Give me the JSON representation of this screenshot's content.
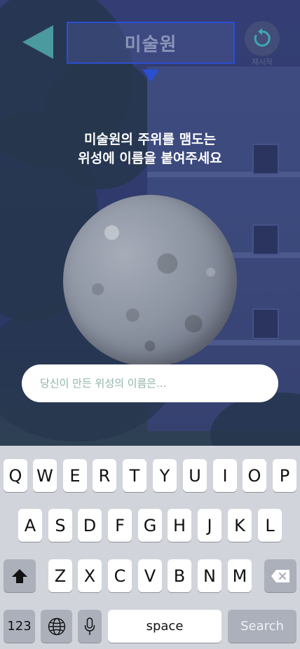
{
  "header": {
    "title": "미술원",
    "reset_label": "재시작"
  },
  "instruction": {
    "line1": "미술원의 주위를 맴도는",
    "line2": "위성에 이름을 붙여주세요"
  },
  "input": {
    "placeholder": "당신이 만든 위성의 이름은...",
    "value": ""
  },
  "keyboard": {
    "row1": [
      "Q",
      "W",
      "E",
      "R",
      "T",
      "Y",
      "U",
      "I",
      "O",
      "P"
    ],
    "row2": [
      "A",
      "S",
      "D",
      "F",
      "G",
      "H",
      "J",
      "K",
      "L"
    ],
    "row3": [
      "Z",
      "X",
      "C",
      "V",
      "B",
      "N",
      "M"
    ],
    "numbers_key": "123",
    "space_key": "space",
    "return_key": "Search"
  },
  "colors": {
    "accent": "#2a4fd0",
    "back_arrow": "#4a9aa0",
    "reset_icon": "#3fa6b4"
  }
}
